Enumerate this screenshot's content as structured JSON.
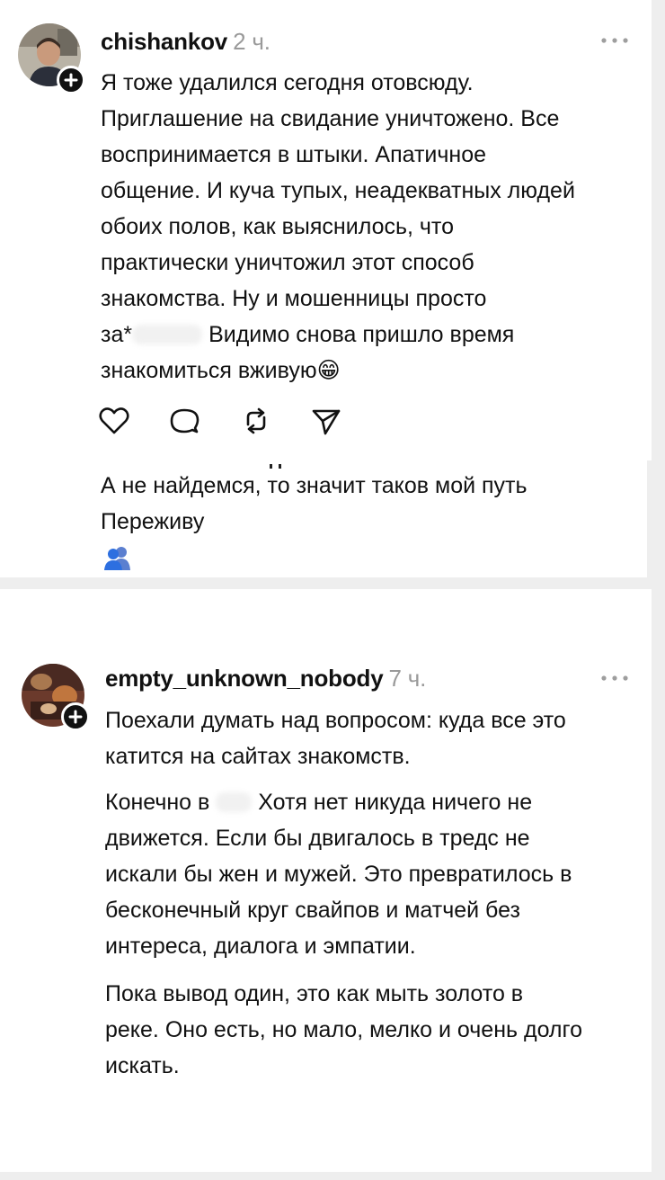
{
  "post1": {
    "username": "chishankov",
    "time": "2 ч.",
    "lines": [
      "Я тоже удалился сегодня отовсюду.",
      "Приглашение на свидание уничтожено. Все",
      "воспринимается в штыки. Апатичное",
      "общение. И куча тупых, неадекватных людей",
      "обоих полов, как выяснилось, что",
      "практически уничтожил этот способ",
      "знакомства. Ну и мошенницы просто"
    ],
    "line8_start": "за*",
    "line8_end": "Видимо снова пришло время",
    "line9": "знакомиться вживую",
    "emoji": "😁",
    "icons": [
      "heart-icon",
      "comment-icon",
      "repost-icon",
      "share-icon"
    ]
  },
  "post2": {
    "lines": [
      "А не найдемся, то значит таков мой путь",
      "Переживу"
    ],
    "icon": "people-emoji-icon"
  },
  "post3": {
    "username": "empty_unknown_nobody",
    "time": "7 ч.",
    "para1": [
      "Поехали думать над вопросом: куда все это",
      "катится на сайтах знакомств."
    ],
    "para2_line1_start": "Конечно в",
    "para2_line1_end": "Хотя нет никуда ничего не",
    "para2": [
      "движется.  Если бы двигалось в тредс не",
      "искали бы жен и мужей. Это превратилось в",
      "бесконечный круг свайпов и матчей без",
      "интереса, диалога и эмпатии."
    ],
    "para3": [
      "Пока вывод один, это как мыть золото в",
      "реке. Оно есть, но мало, мелко и очень долго",
      "искать."
    ]
  }
}
